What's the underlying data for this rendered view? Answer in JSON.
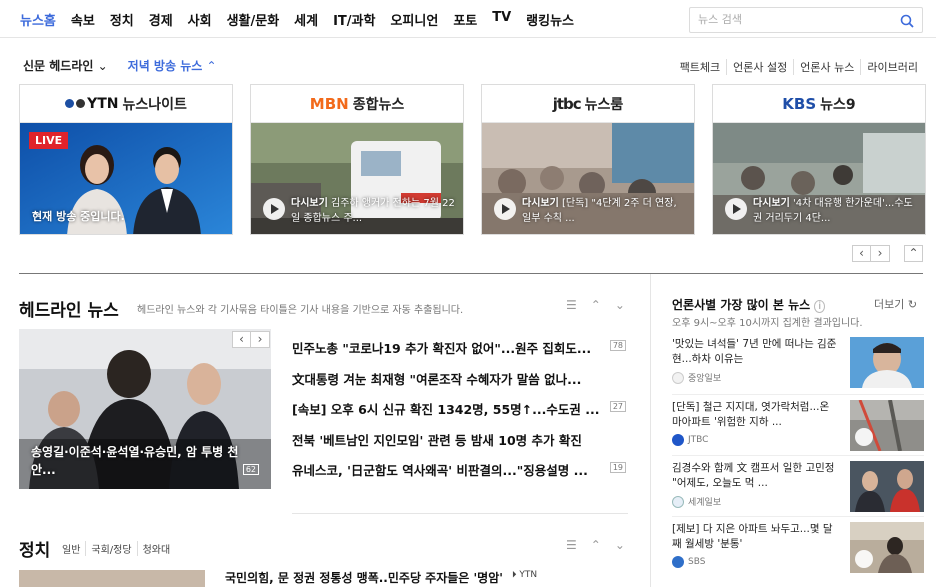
{
  "nav": {
    "items": [
      "뉴스홈",
      "속보",
      "정치",
      "경제",
      "사회",
      "생활/문화",
      "세계",
      "IT/과학",
      "오피니언",
      "포토",
      "TV",
      "랭킹뉴스"
    ],
    "search_placeholder": "뉴스 검색"
  },
  "subtabs": {
    "tab1": "신문 헤드라인",
    "tab2": "저녁 방송 뉴스"
  },
  "right_links": [
    "팩트체크",
    "언론사 설정",
    "언론사 뉴스",
    "라이브러리"
  ],
  "broadcasts": [
    {
      "logo": "YTN",
      "name": "뉴스나이트",
      "live": "LIVE",
      "text": "현재 방송 중입니다."
    },
    {
      "logo": "MBN",
      "name": "종합뉴스",
      "replay": "다시보기",
      "text": "김주하 앵커가 전하는 7월 22일 종합뉴스 주..."
    },
    {
      "logo": "jtbc",
      "name": "뉴스룸",
      "replay": "다시보기",
      "text": "[단독] \"4단계 2주 더 연장, 일부 수칙 ..."
    },
    {
      "logo": "KBS",
      "name": "뉴스9",
      "replay": "다시보기",
      "text": "'4차 대유행 한가운데'...수도권 거리두기 4단..."
    }
  ],
  "headline": {
    "title": "헤드라인 뉴스",
    "desc": "헤드라인 뉴스와 각 기사묶음 타이틀은 기사 내용을 기반으로 자동 추출됩니다.",
    "photo_caption": "송영길·이준석·윤석열·유승민, 암 투병 천안...",
    "photo_count": "62",
    "items": [
      {
        "text": "민주노총 \"코로나19 추가 확진자 없어\"...원주 집회도...",
        "count": "78"
      },
      {
        "text": "文대통령 겨눈 최재형 \"여론조작 수혜자가 말씀 없나...",
        "count": ""
      },
      {
        "text": "[속보] 오후 6시 신규 확진 1342명, 55명↑...수도권 ...",
        "count": "27"
      },
      {
        "text": "전북 '베트남인 지인모임' 관련 등 밤새 10명 추가 확진",
        "count": ""
      },
      {
        "text": "유네스코, '日군함도 역사왜곡' 비판결의...\"징용설명 ...",
        "count": "19"
      }
    ]
  },
  "politics": {
    "title": "정치",
    "subcats": [
      "일반",
      "국회/정당",
      "청와대"
    ],
    "headline": "국민의힘, 문 정권 정통성 맹폭..민주당 주자들은 '명암'",
    "source": "YTN"
  },
  "ranking": {
    "title": "언론사별 가장 많이 본 뉴스",
    "desc": "오후 9시~오후 10시까지 집계한 결과입니다.",
    "more": "더보기",
    "items": [
      {
        "text": "'맛있는 녀석들' 7년 만에 떠나는 김준현...하차 이유는",
        "source": "중앙일보"
      },
      {
        "text": "[단독] 철근 지지대, 엿가락처럼...온 마아파트 '위험한 지하 ...",
        "source": "JTBC"
      },
      {
        "text": "김경수와 함께 文 캠프서 일한 고민정 \"어제도, 오늘도 먹 ...",
        "source": "세계일보"
      },
      {
        "text": "[제보] 다 지은 아파트 놔두고...몇 달째 월세방 '분통'",
        "source": "SBS"
      }
    ]
  }
}
